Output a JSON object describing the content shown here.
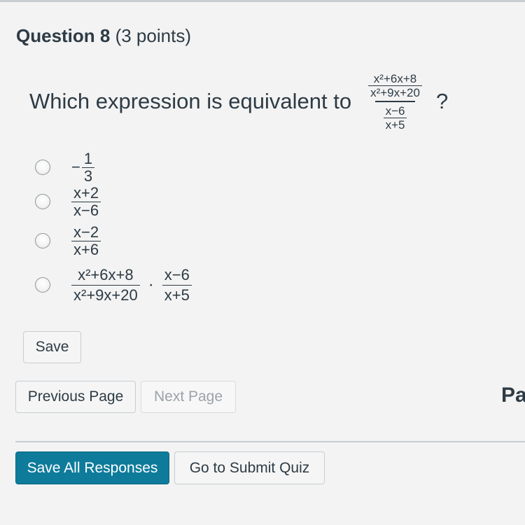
{
  "question": {
    "title": "Question 8",
    "points": "(3 points)",
    "prompt_prefix": "Which expression is equivalent to",
    "prompt_suffix": "?",
    "expression": {
      "top_num": "x²+6x+8",
      "top_den": "x²+9x+20",
      "bottom_num": "x−6",
      "bottom_den": "x+5"
    }
  },
  "options": [
    {
      "sign": "−",
      "num": "1",
      "den": "3"
    },
    {
      "num": "x+2",
      "den": "x−6"
    },
    {
      "num": "x−2",
      "den": "x+6"
    },
    {
      "left_num": "x²+6x+8",
      "left_den": "x²+9x+20",
      "operator": "·",
      "right_num": "x−6",
      "right_den": "x+5"
    }
  ],
  "buttons": {
    "save": "Save",
    "previous_page": "Previous Page",
    "next_page": "Next Page",
    "save_all": "Save All Responses",
    "submit": "Go to Submit Quiz"
  },
  "page_label_partial": "Pa",
  "colors": {
    "primary": "#0e7b9b",
    "text": "#2d3b45",
    "background": "#f3f3f3"
  }
}
